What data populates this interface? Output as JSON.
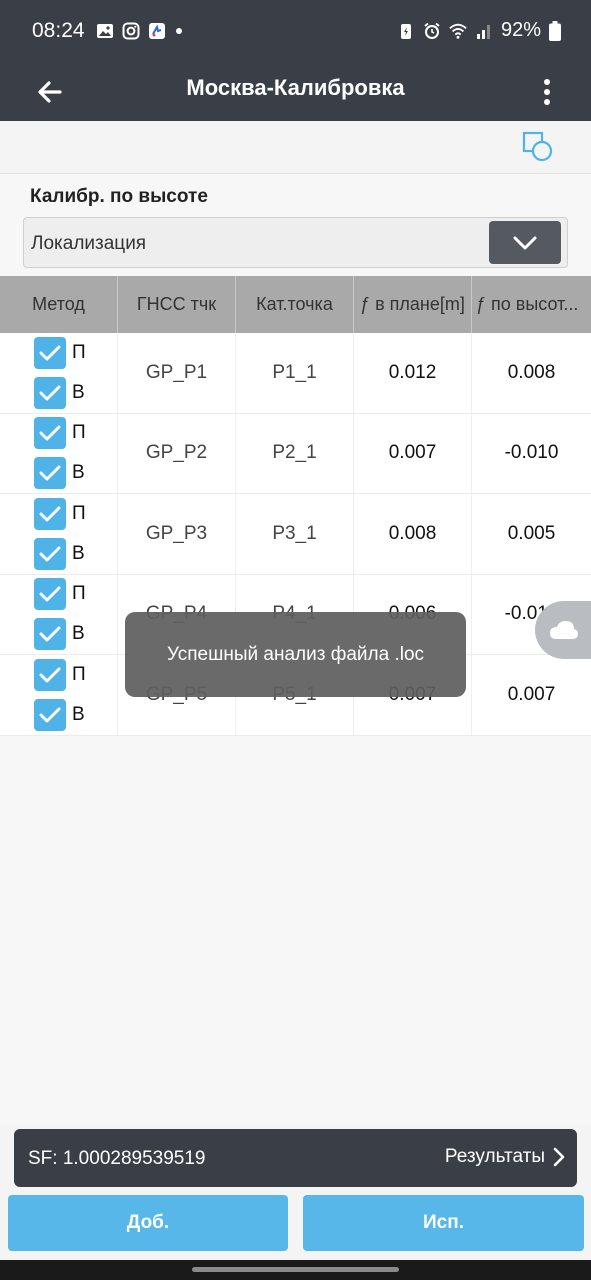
{
  "status_bar": {
    "time": "08:24",
    "battery": "92%",
    "icons_left": [
      "image-icon",
      "instagram-icon",
      "app-icon",
      "dot-icon"
    ],
    "icons_right": [
      "battery-saver-icon",
      "alarm-icon",
      "wifi-icon",
      "signal-icon",
      "battery-icon"
    ]
  },
  "app_bar": {
    "title": "Москва-Калибровка",
    "back_icon": "arrow-left-icon",
    "menu_icon": "more-vertical-icon"
  },
  "toolbar": {
    "shape_icon": "square-circle-icon"
  },
  "calibration": {
    "label": "Калибр. по высоте",
    "selected": "Локализация",
    "dropdown_icon": "chevron-down-icon"
  },
  "table": {
    "columns": [
      "Метод",
      "ГНСС тчк",
      "Кат.точка",
      "ƒ в плане[m]",
      "ƒ по высот..."
    ],
    "rows": [
      {
        "method_h": "П",
        "method_v": "В",
        "gnss": "GP_P1",
        "cat": "P1_1",
        "plan": "0.012",
        "height": "0.008"
      },
      {
        "method_h": "П",
        "method_v": "В",
        "gnss": "GP_P2",
        "cat": "P2_1",
        "plan": "0.007",
        "height": "-0.010"
      },
      {
        "method_h": "П",
        "method_v": "В",
        "gnss": "GP_P3",
        "cat": "P3_1",
        "plan": "0.008",
        "height": "0.005"
      },
      {
        "method_h": "П",
        "method_v": "В",
        "gnss": "GP_P4",
        "cat": "P4_1",
        "plan": "0.006",
        "height": "-0.010"
      },
      {
        "method_h": "П",
        "method_v": "В",
        "gnss": "GP_P5",
        "cat": "P5_1",
        "plan": "0.007",
        "height": "0.007"
      }
    ]
  },
  "toast": {
    "message": "Успешный анализ файла .loc"
  },
  "summary": {
    "sf": "SF: 1.000289539519",
    "results_label": "Результаты"
  },
  "buttons": {
    "add": "Доб.",
    "apply": "Исп."
  },
  "colors": {
    "dark": "#3a3f47",
    "accent": "#57b7e8",
    "checkbox": "#4fb3e8"
  }
}
